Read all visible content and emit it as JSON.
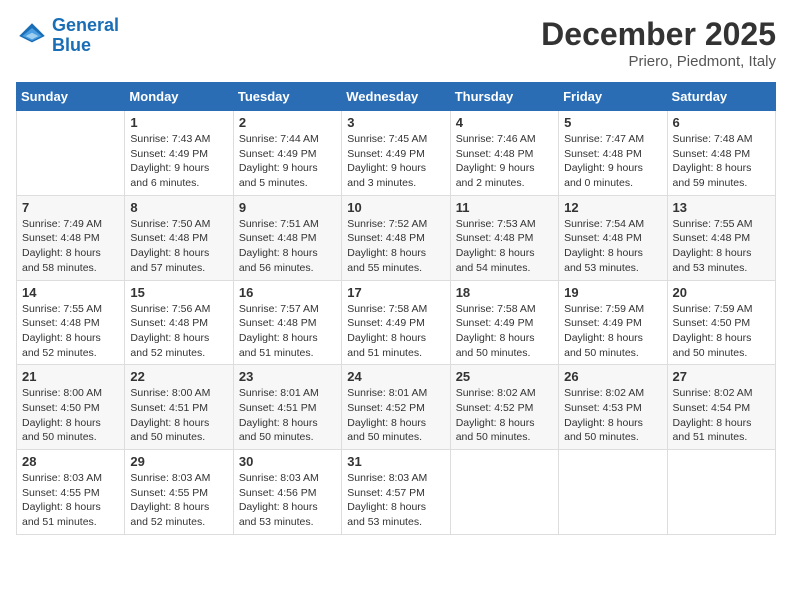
{
  "logo": {
    "line1": "General",
    "line2": "Blue"
  },
  "header": {
    "month": "December 2025",
    "location": "Priero, Piedmont, Italy"
  },
  "weekdays": [
    "Sunday",
    "Monday",
    "Tuesday",
    "Wednesday",
    "Thursday",
    "Friday",
    "Saturday"
  ],
  "weeks": [
    [
      {
        "day": "",
        "sunrise": "",
        "sunset": "",
        "daylight": ""
      },
      {
        "day": "1",
        "sunrise": "Sunrise: 7:43 AM",
        "sunset": "Sunset: 4:49 PM",
        "daylight": "Daylight: 9 hours and 6 minutes."
      },
      {
        "day": "2",
        "sunrise": "Sunrise: 7:44 AM",
        "sunset": "Sunset: 4:49 PM",
        "daylight": "Daylight: 9 hours and 5 minutes."
      },
      {
        "day": "3",
        "sunrise": "Sunrise: 7:45 AM",
        "sunset": "Sunset: 4:49 PM",
        "daylight": "Daylight: 9 hours and 3 minutes."
      },
      {
        "day": "4",
        "sunrise": "Sunrise: 7:46 AM",
        "sunset": "Sunset: 4:48 PM",
        "daylight": "Daylight: 9 hours and 2 minutes."
      },
      {
        "day": "5",
        "sunrise": "Sunrise: 7:47 AM",
        "sunset": "Sunset: 4:48 PM",
        "daylight": "Daylight: 9 hours and 0 minutes."
      },
      {
        "day": "6",
        "sunrise": "Sunrise: 7:48 AM",
        "sunset": "Sunset: 4:48 PM",
        "daylight": "Daylight: 8 hours and 59 minutes."
      }
    ],
    [
      {
        "day": "7",
        "sunrise": "Sunrise: 7:49 AM",
        "sunset": "Sunset: 4:48 PM",
        "daylight": "Daylight: 8 hours and 58 minutes."
      },
      {
        "day": "8",
        "sunrise": "Sunrise: 7:50 AM",
        "sunset": "Sunset: 4:48 PM",
        "daylight": "Daylight: 8 hours and 57 minutes."
      },
      {
        "day": "9",
        "sunrise": "Sunrise: 7:51 AM",
        "sunset": "Sunset: 4:48 PM",
        "daylight": "Daylight: 8 hours and 56 minutes."
      },
      {
        "day": "10",
        "sunrise": "Sunrise: 7:52 AM",
        "sunset": "Sunset: 4:48 PM",
        "daylight": "Daylight: 8 hours and 55 minutes."
      },
      {
        "day": "11",
        "sunrise": "Sunrise: 7:53 AM",
        "sunset": "Sunset: 4:48 PM",
        "daylight": "Daylight: 8 hours and 54 minutes."
      },
      {
        "day": "12",
        "sunrise": "Sunrise: 7:54 AM",
        "sunset": "Sunset: 4:48 PM",
        "daylight": "Daylight: 8 hours and 53 minutes."
      },
      {
        "day": "13",
        "sunrise": "Sunrise: 7:55 AM",
        "sunset": "Sunset: 4:48 PM",
        "daylight": "Daylight: 8 hours and 53 minutes."
      }
    ],
    [
      {
        "day": "14",
        "sunrise": "Sunrise: 7:55 AM",
        "sunset": "Sunset: 4:48 PM",
        "daylight": "Daylight: 8 hours and 52 minutes."
      },
      {
        "day": "15",
        "sunrise": "Sunrise: 7:56 AM",
        "sunset": "Sunset: 4:48 PM",
        "daylight": "Daylight: 8 hours and 52 minutes."
      },
      {
        "day": "16",
        "sunrise": "Sunrise: 7:57 AM",
        "sunset": "Sunset: 4:48 PM",
        "daylight": "Daylight: 8 hours and 51 minutes."
      },
      {
        "day": "17",
        "sunrise": "Sunrise: 7:58 AM",
        "sunset": "Sunset: 4:49 PM",
        "daylight": "Daylight: 8 hours and 51 minutes."
      },
      {
        "day": "18",
        "sunrise": "Sunrise: 7:58 AM",
        "sunset": "Sunset: 4:49 PM",
        "daylight": "Daylight: 8 hours and 50 minutes."
      },
      {
        "day": "19",
        "sunrise": "Sunrise: 7:59 AM",
        "sunset": "Sunset: 4:49 PM",
        "daylight": "Daylight: 8 hours and 50 minutes."
      },
      {
        "day": "20",
        "sunrise": "Sunrise: 7:59 AM",
        "sunset": "Sunset: 4:50 PM",
        "daylight": "Daylight: 8 hours and 50 minutes."
      }
    ],
    [
      {
        "day": "21",
        "sunrise": "Sunrise: 8:00 AM",
        "sunset": "Sunset: 4:50 PM",
        "daylight": "Daylight: 8 hours and 50 minutes."
      },
      {
        "day": "22",
        "sunrise": "Sunrise: 8:00 AM",
        "sunset": "Sunset: 4:51 PM",
        "daylight": "Daylight: 8 hours and 50 minutes."
      },
      {
        "day": "23",
        "sunrise": "Sunrise: 8:01 AM",
        "sunset": "Sunset: 4:51 PM",
        "daylight": "Daylight: 8 hours and 50 minutes."
      },
      {
        "day": "24",
        "sunrise": "Sunrise: 8:01 AM",
        "sunset": "Sunset: 4:52 PM",
        "daylight": "Daylight: 8 hours and 50 minutes."
      },
      {
        "day": "25",
        "sunrise": "Sunrise: 8:02 AM",
        "sunset": "Sunset: 4:52 PM",
        "daylight": "Daylight: 8 hours and 50 minutes."
      },
      {
        "day": "26",
        "sunrise": "Sunrise: 8:02 AM",
        "sunset": "Sunset: 4:53 PM",
        "daylight": "Daylight: 8 hours and 50 minutes."
      },
      {
        "day": "27",
        "sunrise": "Sunrise: 8:02 AM",
        "sunset": "Sunset: 4:54 PM",
        "daylight": "Daylight: 8 hours and 51 minutes."
      }
    ],
    [
      {
        "day": "28",
        "sunrise": "Sunrise: 8:03 AM",
        "sunset": "Sunset: 4:55 PM",
        "daylight": "Daylight: 8 hours and 51 minutes."
      },
      {
        "day": "29",
        "sunrise": "Sunrise: 8:03 AM",
        "sunset": "Sunset: 4:55 PM",
        "daylight": "Daylight: 8 hours and 52 minutes."
      },
      {
        "day": "30",
        "sunrise": "Sunrise: 8:03 AM",
        "sunset": "Sunset: 4:56 PM",
        "daylight": "Daylight: 8 hours and 53 minutes."
      },
      {
        "day": "31",
        "sunrise": "Sunrise: 8:03 AM",
        "sunset": "Sunset: 4:57 PM",
        "daylight": "Daylight: 8 hours and 53 minutes."
      },
      {
        "day": "",
        "sunrise": "",
        "sunset": "",
        "daylight": ""
      },
      {
        "day": "",
        "sunrise": "",
        "sunset": "",
        "daylight": ""
      },
      {
        "day": "",
        "sunrise": "",
        "sunset": "",
        "daylight": ""
      }
    ]
  ]
}
